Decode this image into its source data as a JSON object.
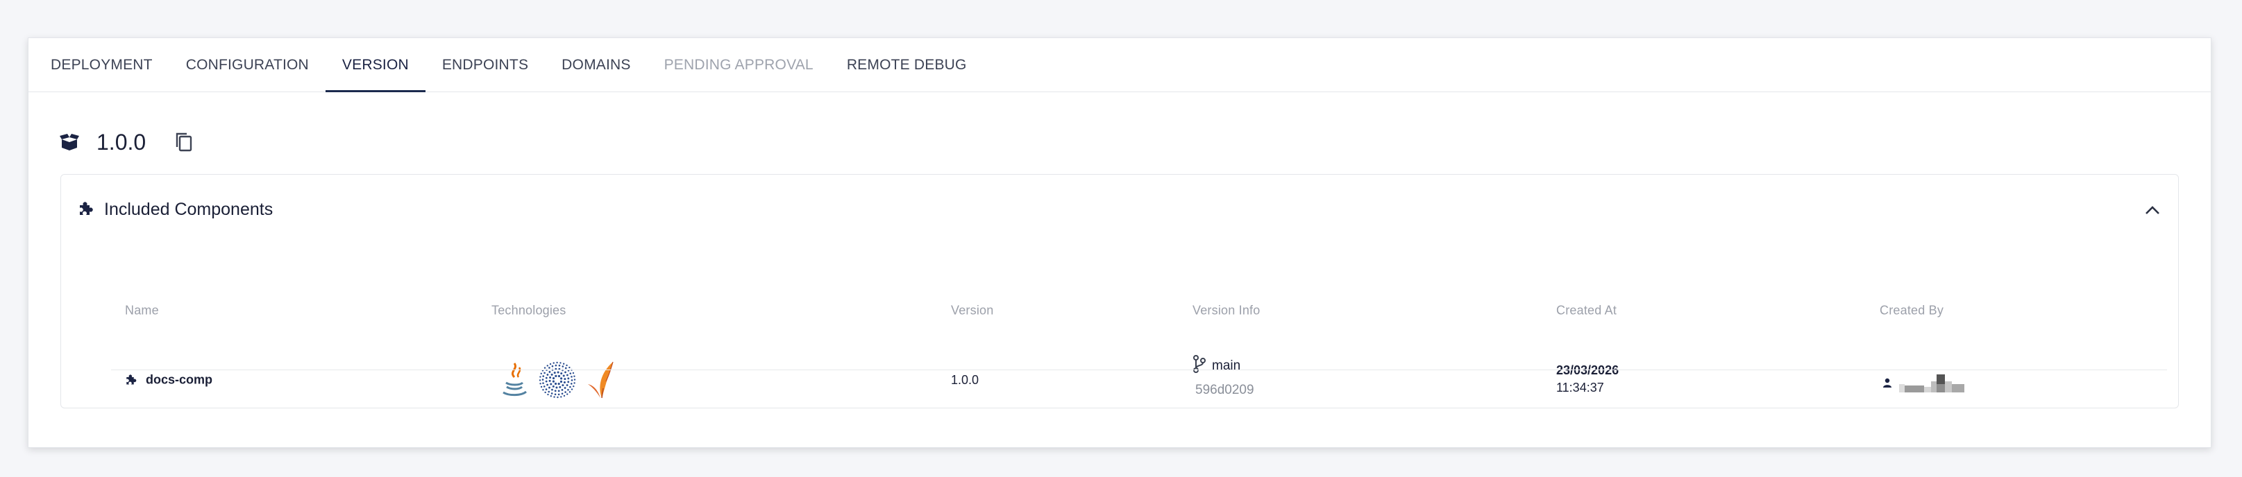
{
  "tabs": [
    {
      "label": "DEPLOYMENT",
      "state": "normal"
    },
    {
      "label": "CONFIGURATION",
      "state": "normal"
    },
    {
      "label": "VERSION",
      "state": "active"
    },
    {
      "label": "ENDPOINTS",
      "state": "normal"
    },
    {
      "label": "DOMAINS",
      "state": "normal"
    },
    {
      "label": "PENDING APPROVAL",
      "state": "disabled"
    },
    {
      "label": "REMOTE DEBUG",
      "state": "normal"
    }
  ],
  "version": {
    "title": "1.0.0",
    "icon": "box-open-icon",
    "copy_icon": "copy-icon"
  },
  "components_panel": {
    "title": "Included Components",
    "icon": "puzzle-icon",
    "collapse_icon": "chevron-up-icon",
    "columns": [
      "Name",
      "Technologies",
      "Version",
      "Version Info",
      "Created At",
      "Created By"
    ],
    "rows": [
      {
        "name": "docs-comp",
        "technologies": [
          "java-icon",
          "spark-icon",
          "kafka-icon"
        ],
        "version": "1.0.0",
        "branch": "main",
        "commit": "596d0209",
        "created_date": "23/03/2026",
        "created_time": "11:34:37",
        "created_by_icon": "user-icon"
      }
    ]
  },
  "colors": {
    "accent": "#1b2a4e",
    "text": "#1a1f36",
    "muted": "#9ca0aa",
    "disabled_tab": "#9ea3ad",
    "java_orange": "#e76f00",
    "java_blue": "#5382a1",
    "spark_blue": "#2a4d8f"
  }
}
